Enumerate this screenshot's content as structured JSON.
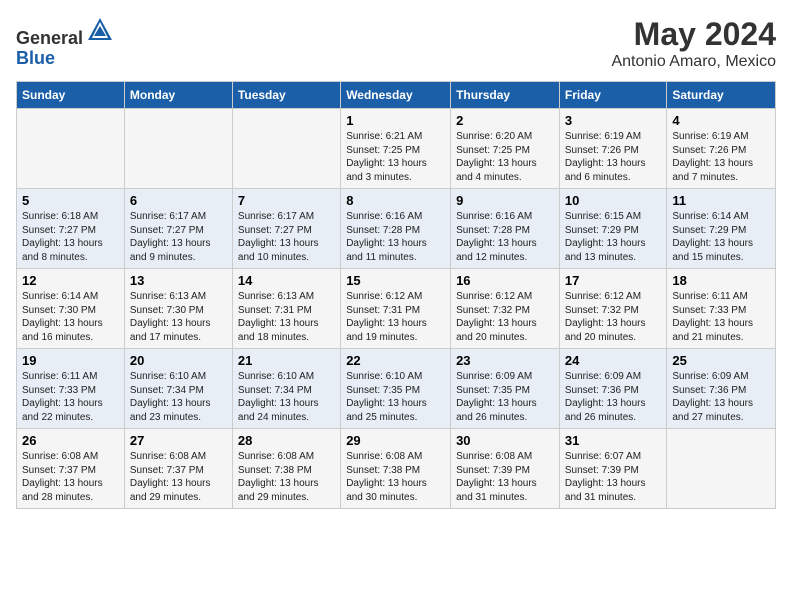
{
  "header": {
    "logo_general": "General",
    "logo_blue": "Blue",
    "month_year": "May 2024",
    "location": "Antonio Amaro, Mexico"
  },
  "days_of_week": [
    "Sunday",
    "Monday",
    "Tuesday",
    "Wednesday",
    "Thursday",
    "Friday",
    "Saturday"
  ],
  "weeks": [
    [
      {
        "day": "",
        "sunrise": "",
        "sunset": "",
        "daylight": ""
      },
      {
        "day": "",
        "sunrise": "",
        "sunset": "",
        "daylight": ""
      },
      {
        "day": "",
        "sunrise": "",
        "sunset": "",
        "daylight": ""
      },
      {
        "day": "1",
        "sunrise": "Sunrise: 6:21 AM",
        "sunset": "Sunset: 7:25 PM",
        "daylight": "Daylight: 13 hours and 3 minutes."
      },
      {
        "day": "2",
        "sunrise": "Sunrise: 6:20 AM",
        "sunset": "Sunset: 7:25 PM",
        "daylight": "Daylight: 13 hours and 4 minutes."
      },
      {
        "day": "3",
        "sunrise": "Sunrise: 6:19 AM",
        "sunset": "Sunset: 7:26 PM",
        "daylight": "Daylight: 13 hours and 6 minutes."
      },
      {
        "day": "4",
        "sunrise": "Sunrise: 6:19 AM",
        "sunset": "Sunset: 7:26 PM",
        "daylight": "Daylight: 13 hours and 7 minutes."
      }
    ],
    [
      {
        "day": "5",
        "sunrise": "Sunrise: 6:18 AM",
        "sunset": "Sunset: 7:27 PM",
        "daylight": "Daylight: 13 hours and 8 minutes."
      },
      {
        "day": "6",
        "sunrise": "Sunrise: 6:17 AM",
        "sunset": "Sunset: 7:27 PM",
        "daylight": "Daylight: 13 hours and 9 minutes."
      },
      {
        "day": "7",
        "sunrise": "Sunrise: 6:17 AM",
        "sunset": "Sunset: 7:27 PM",
        "daylight": "Daylight: 13 hours and 10 minutes."
      },
      {
        "day": "8",
        "sunrise": "Sunrise: 6:16 AM",
        "sunset": "Sunset: 7:28 PM",
        "daylight": "Daylight: 13 hours and 11 minutes."
      },
      {
        "day": "9",
        "sunrise": "Sunrise: 6:16 AM",
        "sunset": "Sunset: 7:28 PM",
        "daylight": "Daylight: 13 hours and 12 minutes."
      },
      {
        "day": "10",
        "sunrise": "Sunrise: 6:15 AM",
        "sunset": "Sunset: 7:29 PM",
        "daylight": "Daylight: 13 hours and 13 minutes."
      },
      {
        "day": "11",
        "sunrise": "Sunrise: 6:14 AM",
        "sunset": "Sunset: 7:29 PM",
        "daylight": "Daylight: 13 hours and 15 minutes."
      }
    ],
    [
      {
        "day": "12",
        "sunrise": "Sunrise: 6:14 AM",
        "sunset": "Sunset: 7:30 PM",
        "daylight": "Daylight: 13 hours and 16 minutes."
      },
      {
        "day": "13",
        "sunrise": "Sunrise: 6:13 AM",
        "sunset": "Sunset: 7:30 PM",
        "daylight": "Daylight: 13 hours and 17 minutes."
      },
      {
        "day": "14",
        "sunrise": "Sunrise: 6:13 AM",
        "sunset": "Sunset: 7:31 PM",
        "daylight": "Daylight: 13 hours and 18 minutes."
      },
      {
        "day": "15",
        "sunrise": "Sunrise: 6:12 AM",
        "sunset": "Sunset: 7:31 PM",
        "daylight": "Daylight: 13 hours and 19 minutes."
      },
      {
        "day": "16",
        "sunrise": "Sunrise: 6:12 AM",
        "sunset": "Sunset: 7:32 PM",
        "daylight": "Daylight: 13 hours and 20 minutes."
      },
      {
        "day": "17",
        "sunrise": "Sunrise: 6:12 AM",
        "sunset": "Sunset: 7:32 PM",
        "daylight": "Daylight: 13 hours and 20 minutes."
      },
      {
        "day": "18",
        "sunrise": "Sunrise: 6:11 AM",
        "sunset": "Sunset: 7:33 PM",
        "daylight": "Daylight: 13 hours and 21 minutes."
      }
    ],
    [
      {
        "day": "19",
        "sunrise": "Sunrise: 6:11 AM",
        "sunset": "Sunset: 7:33 PM",
        "daylight": "Daylight: 13 hours and 22 minutes."
      },
      {
        "day": "20",
        "sunrise": "Sunrise: 6:10 AM",
        "sunset": "Sunset: 7:34 PM",
        "daylight": "Daylight: 13 hours and 23 minutes."
      },
      {
        "day": "21",
        "sunrise": "Sunrise: 6:10 AM",
        "sunset": "Sunset: 7:34 PM",
        "daylight": "Daylight: 13 hours and 24 minutes."
      },
      {
        "day": "22",
        "sunrise": "Sunrise: 6:10 AM",
        "sunset": "Sunset: 7:35 PM",
        "daylight": "Daylight: 13 hours and 25 minutes."
      },
      {
        "day": "23",
        "sunrise": "Sunrise: 6:09 AM",
        "sunset": "Sunset: 7:35 PM",
        "daylight": "Daylight: 13 hours and 26 minutes."
      },
      {
        "day": "24",
        "sunrise": "Sunrise: 6:09 AM",
        "sunset": "Sunset: 7:36 PM",
        "daylight": "Daylight: 13 hours and 26 minutes."
      },
      {
        "day": "25",
        "sunrise": "Sunrise: 6:09 AM",
        "sunset": "Sunset: 7:36 PM",
        "daylight": "Daylight: 13 hours and 27 minutes."
      }
    ],
    [
      {
        "day": "26",
        "sunrise": "Sunrise: 6:08 AM",
        "sunset": "Sunset: 7:37 PM",
        "daylight": "Daylight: 13 hours and 28 minutes."
      },
      {
        "day": "27",
        "sunrise": "Sunrise: 6:08 AM",
        "sunset": "Sunset: 7:37 PM",
        "daylight": "Daylight: 13 hours and 29 minutes."
      },
      {
        "day": "28",
        "sunrise": "Sunrise: 6:08 AM",
        "sunset": "Sunset: 7:38 PM",
        "daylight": "Daylight: 13 hours and 29 minutes."
      },
      {
        "day": "29",
        "sunrise": "Sunrise: 6:08 AM",
        "sunset": "Sunset: 7:38 PM",
        "daylight": "Daylight: 13 hours and 30 minutes."
      },
      {
        "day": "30",
        "sunrise": "Sunrise: 6:08 AM",
        "sunset": "Sunset: 7:39 PM",
        "daylight": "Daylight: 13 hours and 31 minutes."
      },
      {
        "day": "31",
        "sunrise": "Sunrise: 6:07 AM",
        "sunset": "Sunset: 7:39 PM",
        "daylight": "Daylight: 13 hours and 31 minutes."
      },
      {
        "day": "",
        "sunrise": "",
        "sunset": "",
        "daylight": ""
      }
    ]
  ]
}
